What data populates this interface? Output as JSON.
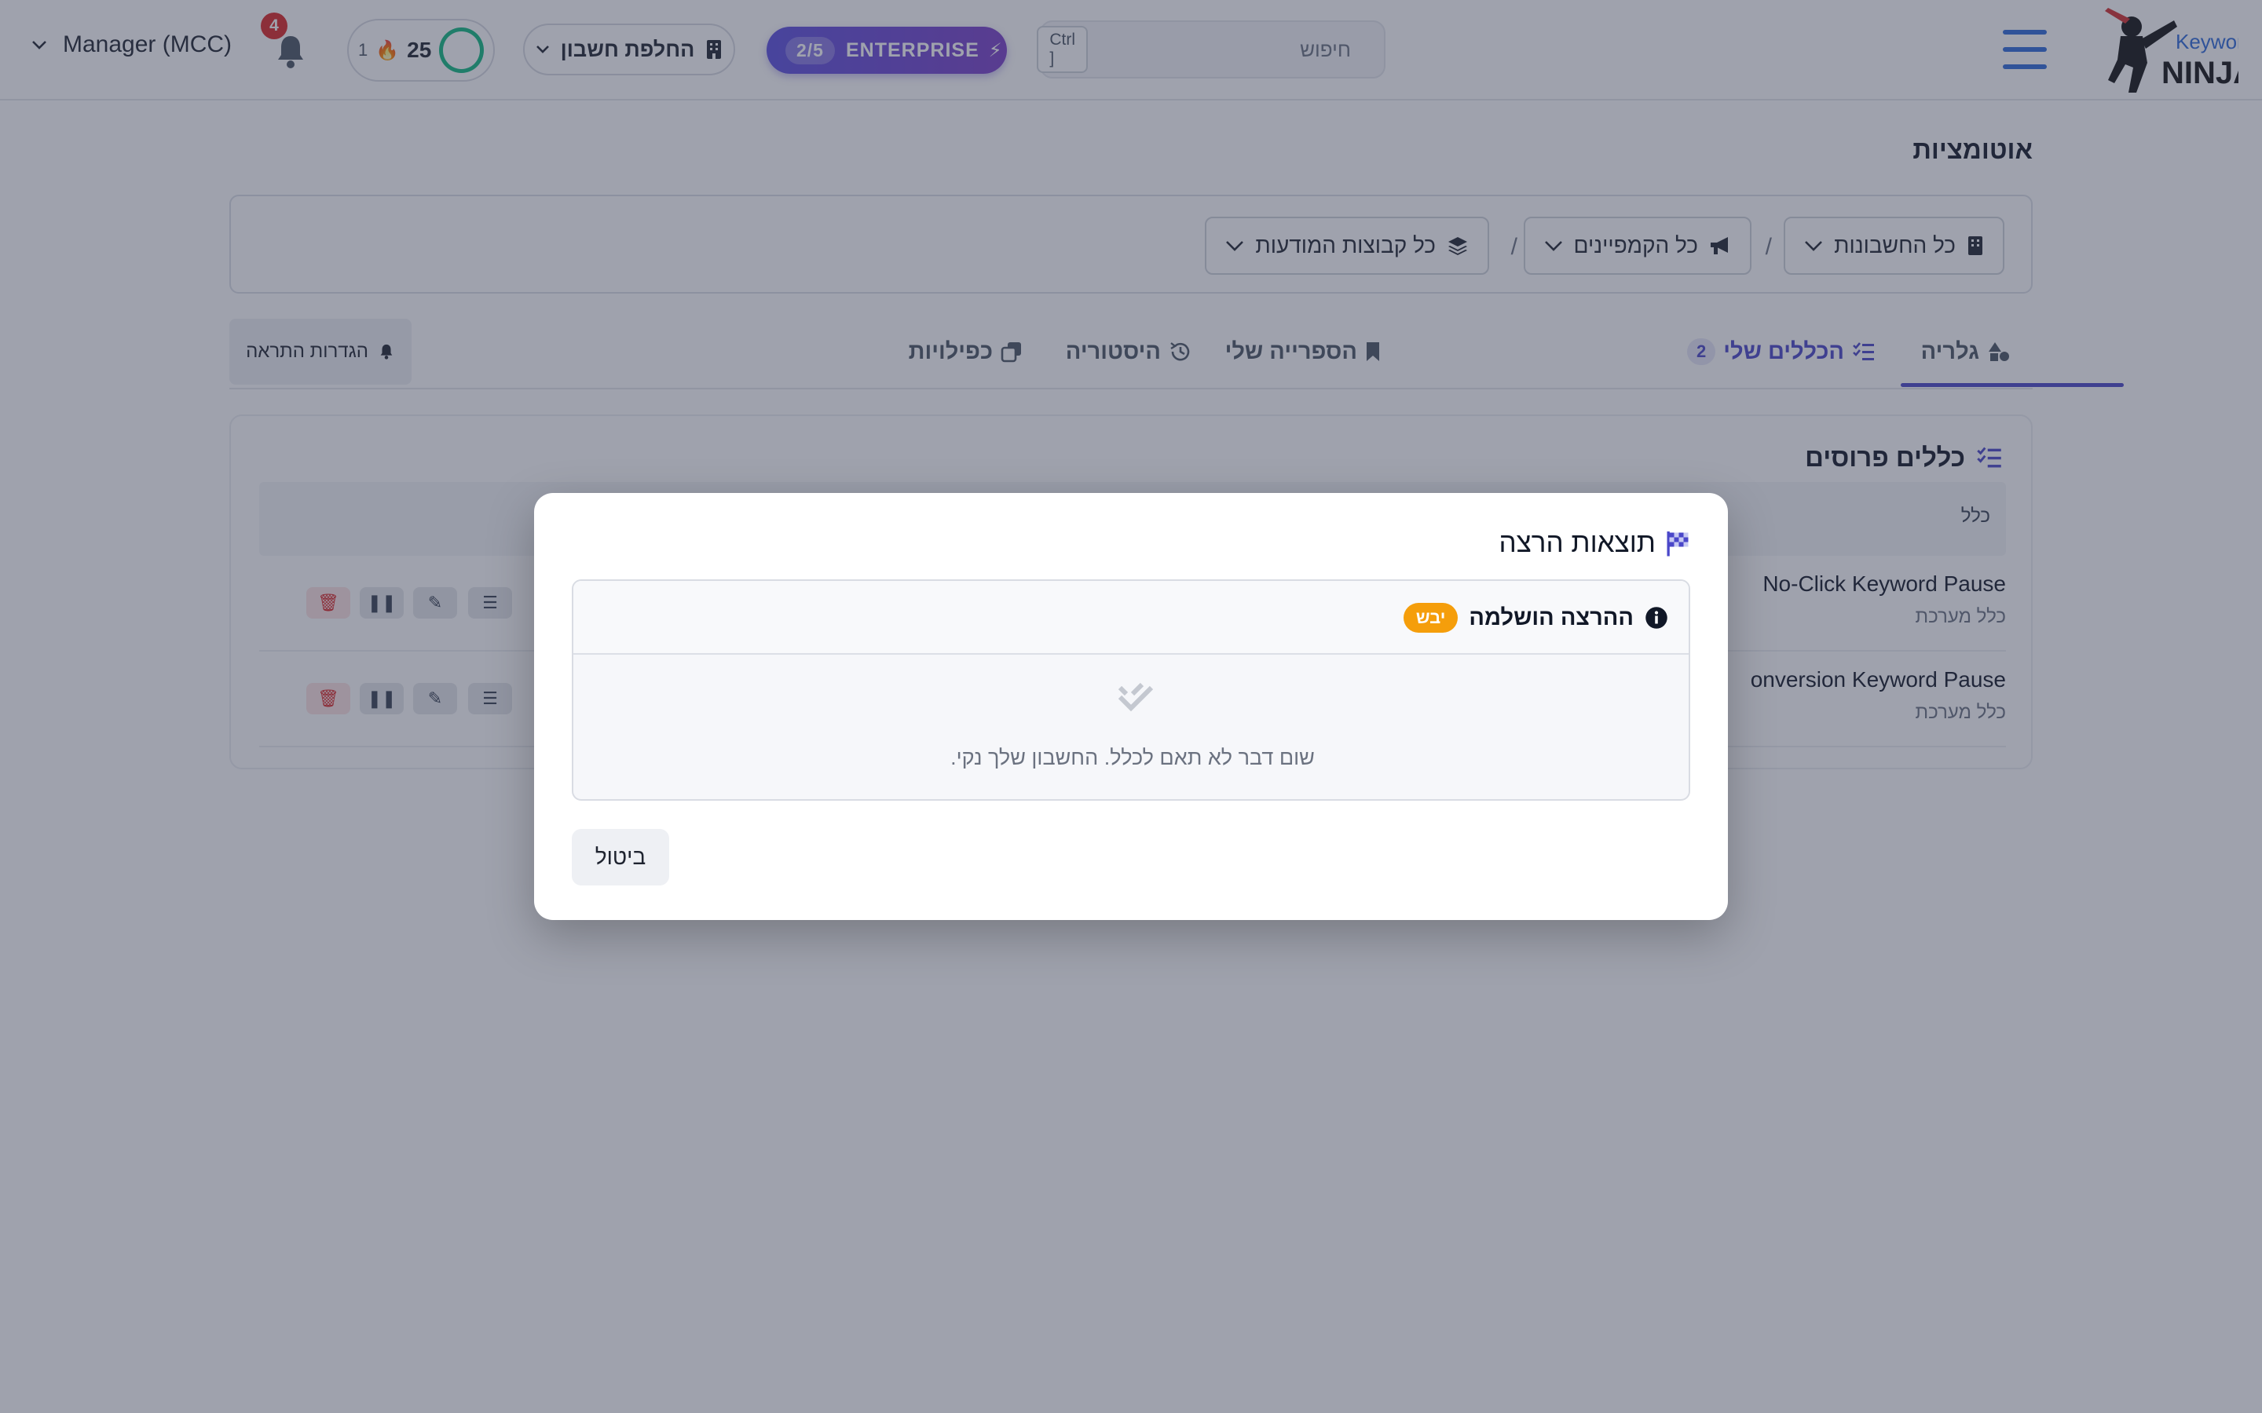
{
  "header": {
    "logo_text_top": "Keyword",
    "logo_text_bottom": "NINJA",
    "search_placeholder": "חיפוש",
    "search_shortcut": "Ctrl ]",
    "plan_label": "ENTERPRISE",
    "plan_usage": "2/5",
    "switch_account_label": "החלפת חשבון",
    "score": "25",
    "streak": "1",
    "notifications_count": "4",
    "account_name": "Manager (MCC)"
  },
  "page": {
    "title": "אוטומציות",
    "filters": {
      "accounts": "כל החשבונות",
      "campaigns": "כל הקמפיינים",
      "ad_groups": "כל קבוצות המודעות",
      "separator": "/"
    },
    "tabs": [
      {
        "label": "גלריה"
      },
      {
        "label": "הכללים שלי",
        "count": "2"
      },
      {
        "label": "הספרייה שלי"
      },
      {
        "label": "היסטוריה"
      },
      {
        "label": "כפילויות"
      }
    ],
    "alert_settings": "הגדרות התראה",
    "card": {
      "title": "כללים פרוסים",
      "column_rule": "כלל",
      "rules": [
        {
          "name": "No-Click Keyword Pause",
          "type": "כלל מערכת"
        },
        {
          "name": "onversion Keyword Pause",
          "type": "כלל מערכת"
        }
      ]
    }
  },
  "modal": {
    "title": "תוצאות הרצה",
    "status_label": "ההרצה הושלמה",
    "status_badge": "יבש",
    "empty_message": "שום דבר לא תאם לכלל. החשבון שלך נקי.",
    "cancel_label": "ביטול"
  },
  "colors": {
    "accent": "#4a47c9",
    "hamburger": "#2f6ad9",
    "badge_dry": "#f59e0b",
    "notification": "#dc2626",
    "ring": "#10b981",
    "delete": "#dc2626"
  }
}
